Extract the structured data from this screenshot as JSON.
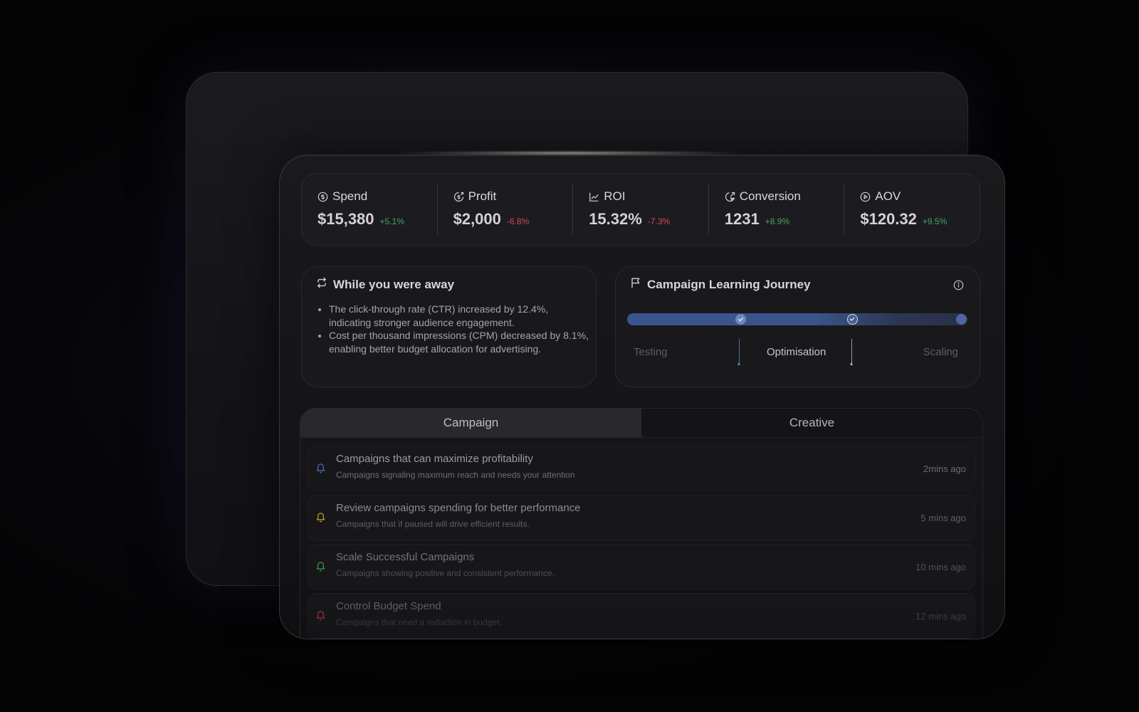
{
  "metrics": [
    {
      "label": "Spend",
      "value": "$15,380",
      "delta": "+5.1%",
      "trend": "up",
      "icon": "dollar-circle-icon"
    },
    {
      "label": "Profit",
      "value": "$2,000",
      "delta": "-6.8%",
      "trend": "down",
      "icon": "coin-refresh-icon"
    },
    {
      "label": "ROI",
      "value": "15.32%",
      "delta": "-7.3%",
      "trend": "down",
      "icon": "line-chart-icon"
    },
    {
      "label": "Conversion",
      "value": "1231",
      "delta": "+8.9%",
      "trend": "up",
      "icon": "conversion-icon"
    },
    {
      "label": "AOV",
      "value": "$120.32",
      "delta": "+9.5%",
      "trend": "up",
      "icon": "play-circle-icon"
    }
  ],
  "away": {
    "title": "While you were away",
    "icon": "repeat-icon",
    "items": [
      "The click-through rate (CTR) increased by 12.4%, indicating stronger audience engagement.",
      "Cost per thousand impressions (CPM) decreased by 8.1%, enabling better budget allocation for advertising."
    ]
  },
  "journey": {
    "title": "Campaign Learning Journey",
    "icon": "flag-icon",
    "stages": [
      "Testing",
      "Optimisation",
      "Scaling"
    ],
    "current_stage": "Optimisation"
  },
  "tabs": [
    {
      "label": "Campaign",
      "active": true
    },
    {
      "label": "Creative",
      "active": false
    }
  ],
  "notifications": [
    {
      "title": "Campaigns that can maximize profitability",
      "subtitle": "Campaigns signaling maximum reach and needs your attention",
      "time": "2mins ago",
      "color": "#4f6fb8"
    },
    {
      "title": "Review campaigns spending for better performance",
      "subtitle": "Campaigns that if paused will drive efficient results.",
      "time": "5 mins ago",
      "color": "#c9a227"
    },
    {
      "title": "Scale Successful Campaigns",
      "subtitle": "Campaigns showing positive and consistent performance.",
      "time": "10 mins ago",
      "color": "#3e9a4e"
    },
    {
      "title": "Control Budget Spend",
      "subtitle": "Campaigns that need a reduction in budget.",
      "time": "12 mins ago",
      "color": "#b13a3e"
    }
  ],
  "colors": {
    "positive": "#46a758",
    "negative": "#d6484d",
    "accent": "#3a558e"
  }
}
